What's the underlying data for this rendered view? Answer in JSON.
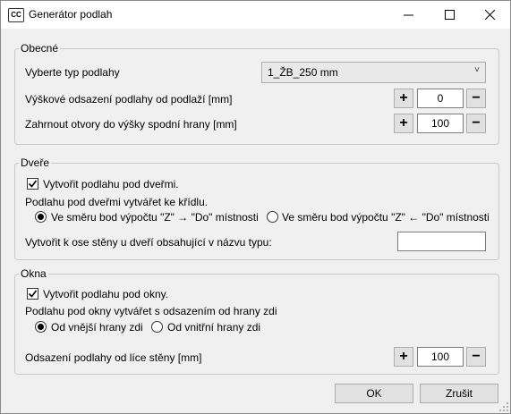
{
  "window": {
    "title": "Generátor podlah",
    "app_icon_text": "CC"
  },
  "general": {
    "legend": "Obecné",
    "floor_type_label": "Vyberte typ podlahy",
    "floor_type_value": "1_ŽB_250 mm",
    "height_offset_label": "Výškové odsazení podlahy od podlaží [mm]",
    "height_offset_value": "0",
    "openings_label": "Zahrnout otvory do výšky spodní hrany [mm]",
    "openings_value": "100"
  },
  "doors": {
    "legend": "Dveře",
    "create_checkbox_label": "Vytvořit podlahu pod dveřmi.",
    "create_checked": true,
    "create_at_label": "Podlahu pod dveřmi vytvářet ke křídlu.",
    "radio_forward_label": "Ve směru bod výpočtu \"Z\" → \"Do\" místnosti",
    "radio_backward_label": "Ve směru bod výpočtu \"Z\" ← \"Do\" místnosti",
    "selected_radio": "forward",
    "wall_axis_label": "Vytvořit k ose stěny u dveří obsahující v názvu typu:",
    "wall_axis_value": ""
  },
  "windows": {
    "legend": "Okna",
    "create_checkbox_label": "Vytvořit podlahu pod okny.",
    "create_checked": true,
    "offset_from_edge_label": "Podlahu pod okny vytvářet s odsazením od hrany zdi",
    "radio_outer_label": "Od vnější hrany zdi",
    "radio_inner_label": "Od vnitřní hrany zdi",
    "selected_radio": "outer",
    "wall_face_offset_label": "Odsazení podlahy od líce stěny [mm]",
    "wall_face_offset_value": "100"
  },
  "buttons": {
    "ok": "OK",
    "cancel": "Zrušit",
    "plus": "+",
    "minus": "−"
  }
}
